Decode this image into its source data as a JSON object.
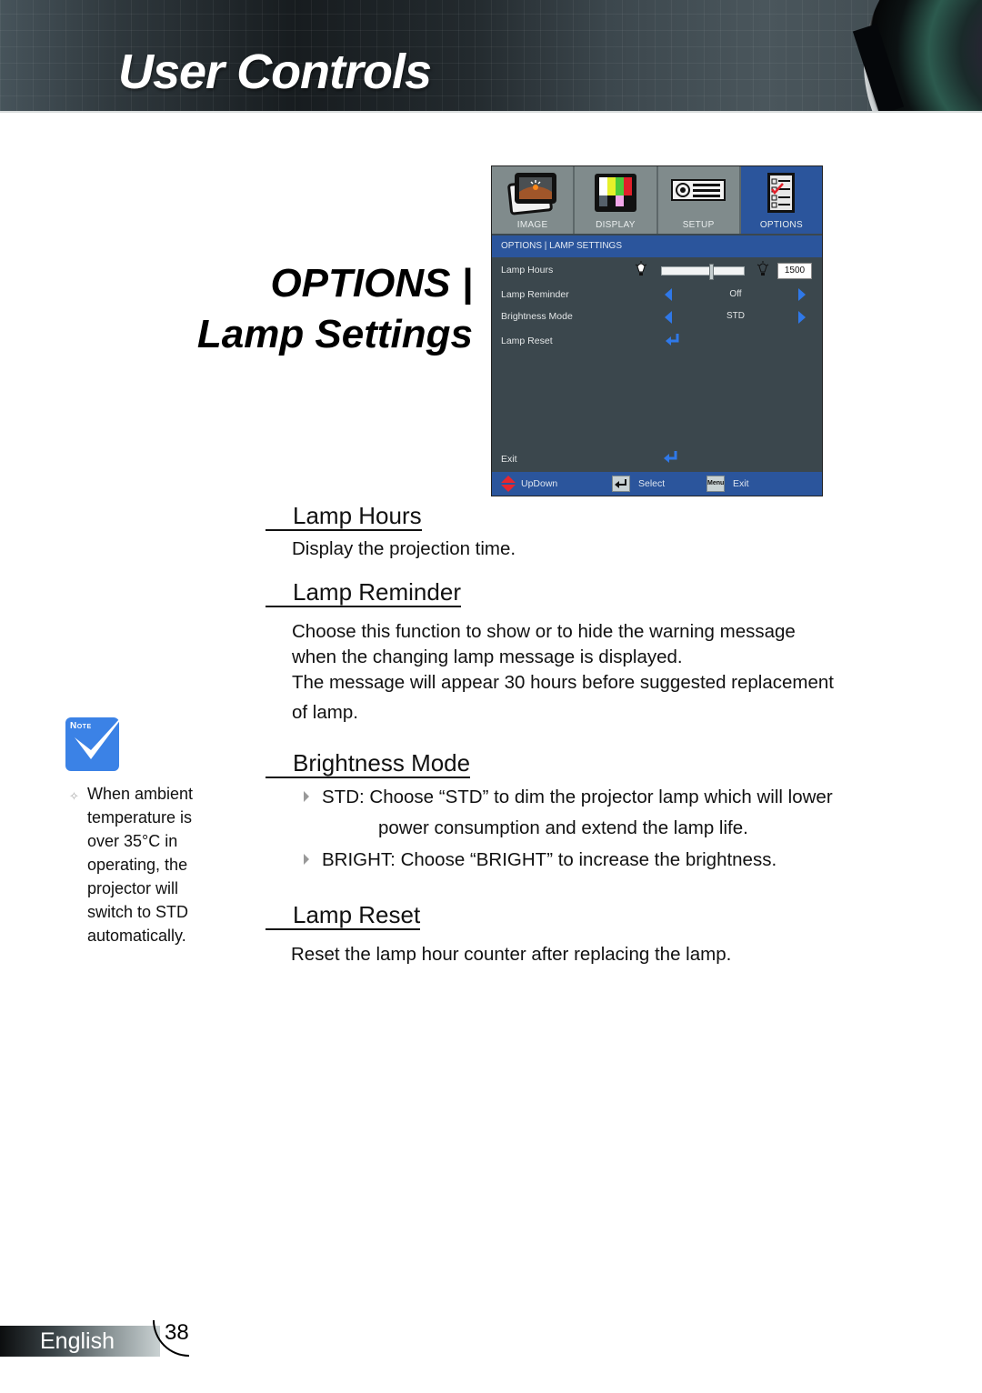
{
  "header": {
    "title": "User Controls"
  },
  "section": {
    "title_line1": "OPTIONS |",
    "title_line2": "Lamp Settings"
  },
  "osd": {
    "tabs": [
      {
        "label": "IMAGE",
        "icon": "image-icon",
        "active": false
      },
      {
        "label": "DISPLAY",
        "icon": "display-icon",
        "active": false
      },
      {
        "label": "SETUP",
        "icon": "setup-icon",
        "active": false
      },
      {
        "label": "OPTIONS",
        "icon": "options-icon",
        "active": true
      }
    ],
    "breadcrumb": "OPTIONS | LAMP SETTINGS",
    "rows": {
      "lamp_hours": {
        "label": "Lamp Hours",
        "value": "1500",
        "slider_fraction": 0.6
      },
      "lamp_reminder": {
        "label": "Lamp Reminder",
        "value": "Off"
      },
      "brightness_mode": {
        "label": "Brightness Mode",
        "value": "STD"
      },
      "lamp_reset": {
        "label": "Lamp Reset"
      }
    },
    "exit_label": "Exit",
    "footer": {
      "updown": "UpDown",
      "select": "Select",
      "menu_key": "Menu",
      "exit": "Exit"
    },
    "colors": {
      "accent": "#2b559c",
      "panel": "#3b474d",
      "arrow": "#2f78e8"
    }
  },
  "content": {
    "lamp_hours": {
      "heading": "Lamp Hours",
      "text": "Display the projection time."
    },
    "lamp_reminder": {
      "heading": "Lamp Reminder",
      "line1": "Choose this function to show or to hide the warning message",
      "line2": "when the changing lamp message is displayed.",
      "line3": "The message will appear 30 hours before suggested replacement",
      "line4": "of lamp."
    },
    "brightness_mode": {
      "heading": "Brightness Mode",
      "bullet1_line1": "STD: Choose “STD” to dim the projector lamp which will lower",
      "bullet1_line2": "power consumption and extend the lamp life.",
      "bullet2": "BRIGHT: Choose “BRIGHT” to increase the brightness."
    },
    "lamp_reset": {
      "heading": "Lamp Reset",
      "text": "Reset the lamp hour counter after replacing the lamp."
    }
  },
  "note": {
    "label": "Note",
    "bullet": "✧",
    "text": "When ambient temperature is over 35°C in operating, the projector will switch to STD automatically."
  },
  "footer": {
    "language": "English",
    "page_number": "38"
  }
}
